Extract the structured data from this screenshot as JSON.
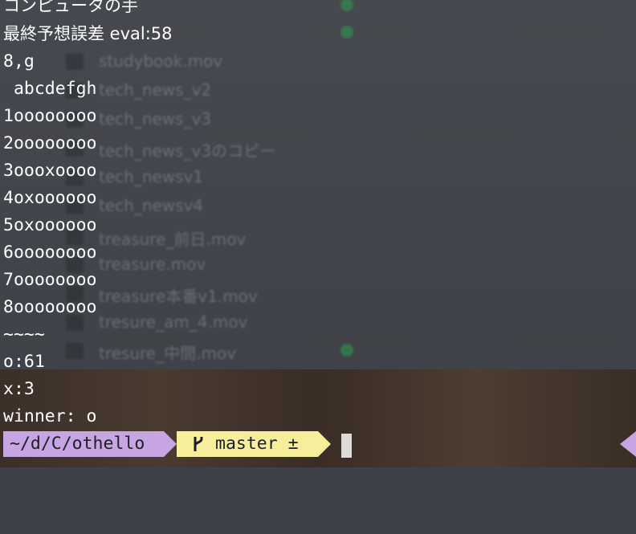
{
  "background": {
    "files": [
      {
        "name": "studybook.mov",
        "checked": false
      },
      {
        "name": "tech_news_v2",
        "checked": false
      },
      {
        "name": "tech_news_v3",
        "checked": false
      },
      {
        "name": "tech_news_v3のコピー",
        "checked": false
      },
      {
        "name": "tech_newsv1",
        "checked": false
      },
      {
        "name": "tech_newsv4",
        "checked": false
      },
      {
        "name": "treasure_前日.mov",
        "checked": false
      },
      {
        "name": "treasure.mov",
        "checked": false
      },
      {
        "name": "treasure本番v1.mov",
        "checked": false
      },
      {
        "name": "tresure_am_4.mov",
        "checked": false
      },
      {
        "name": "tresure_中間.mov",
        "checked": true
      }
    ]
  },
  "terminal": {
    "lines": [
      "コンピュータの手",
      "最終予想誤差 eval:58",
      "8,g",
      " abcdefgh",
      "1oooooooo",
      "2oooooooo",
      "3oooxoooo",
      "4oxoooooo",
      "5oxoooooo",
      "6oooooooo",
      "7oooooooo",
      "8oooooooo",
      "~~~~",
      "o:61",
      "x:3",
      "winner: o"
    ]
  },
  "prompt": {
    "directory": "~/d/C/othello",
    "branch_icon": "git-branch-icon",
    "branch": "master ±"
  },
  "colors": {
    "dir_segment": "#c7a4e2",
    "git_segment": "#f6ee9a",
    "text": "#ffffff",
    "check": "#2f9e4c"
  }
}
